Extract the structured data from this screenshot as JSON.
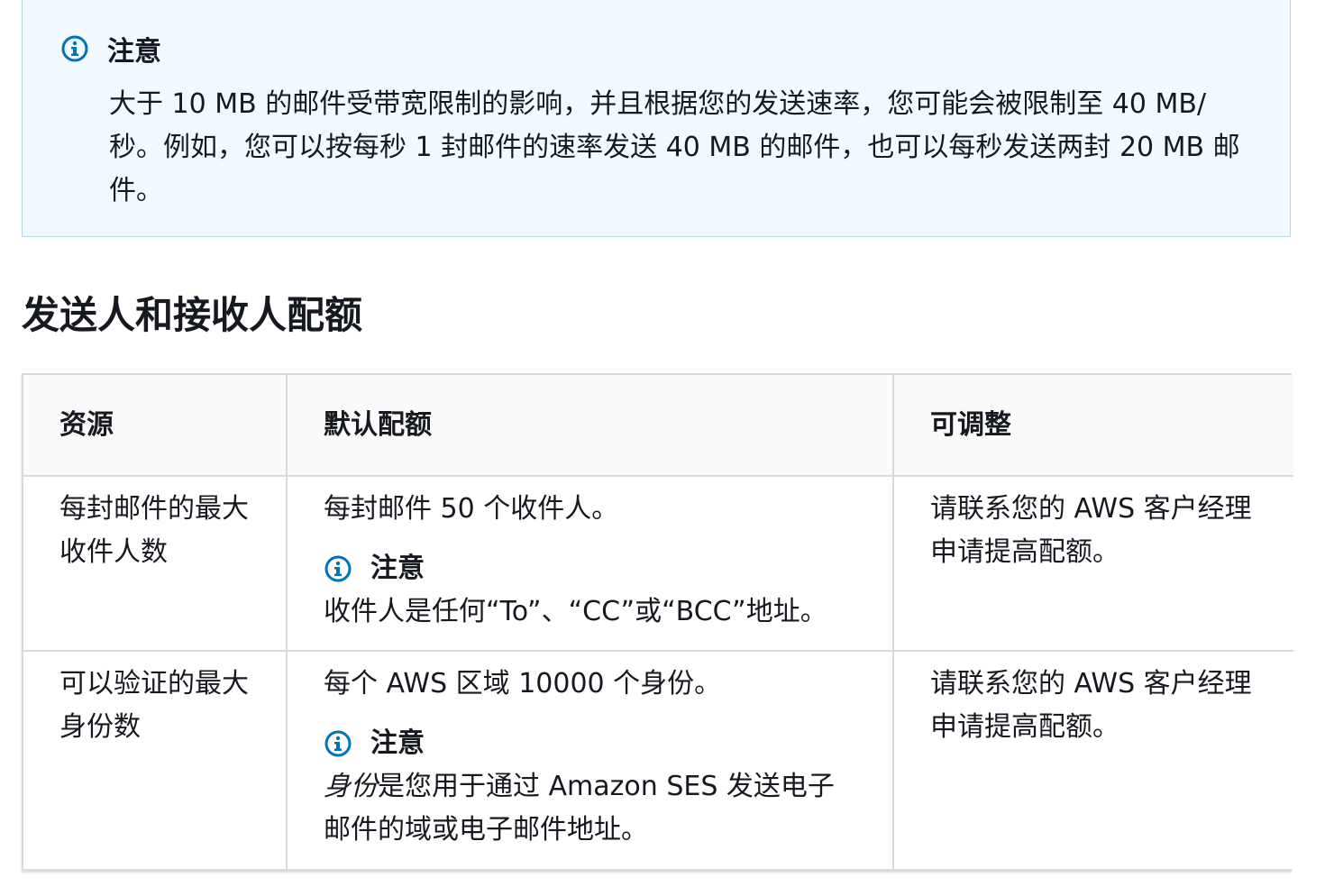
{
  "note_box": {
    "icon": "info-icon",
    "title": "注意",
    "body": "大于 10 MB 的邮件受带宽限制的影响，并且根据您的发送速率，您可能会被限制至 40 MB/秒。例如，您可以按每秒 1 封邮件的速率发送 40 MB 的邮件，也可以每秒发送两封 20 MB 邮件。"
  },
  "section": {
    "title": "发送人和接收人配额"
  },
  "table": {
    "headers": [
      "资源",
      "默认配额",
      "可调整"
    ],
    "rows": [
      {
        "resource": "每封邮件的最大收件人数",
        "quota": "每封邮件 50 个收件人。",
        "note_title": "注意",
        "note_italic": "",
        "note_text": "收件人是任何“To”、“CC”或“BCC”地址。",
        "adjustable": "请联系您的 AWS 客户经理申请提高配额。"
      },
      {
        "resource": "可以验证的最大身份数",
        "quota": "每个 AWS 区域 10000 个身份。",
        "note_title": "注意",
        "note_italic": "身份",
        "note_text": "是您用于通过 Amazon SES 发送电子邮件的域或电子邮件地址。",
        "adjustable": "请联系您的 AWS 客户经理申请提高配额。"
      }
    ]
  },
  "colors": {
    "note_bg": "#f1faff",
    "note_border": "#b3d7f0",
    "icon_blue": "#0073bb",
    "text": "#16191f",
    "table_border": "#d5dbdb"
  }
}
